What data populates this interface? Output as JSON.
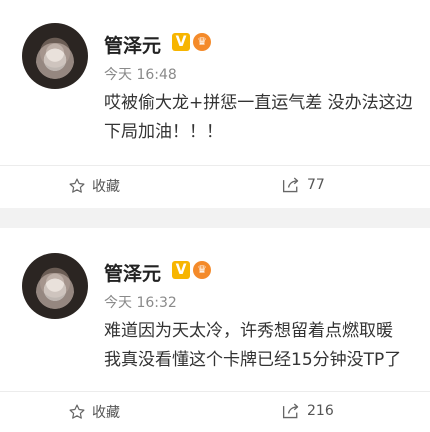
{
  "posts": [
    {
      "author": "管泽元",
      "badge_v": "V",
      "time": "今天 16:48",
      "lines": [
        "哎被偷大龙+拼惩一直运气差 没办法这边",
        "下局加油！！！"
      ],
      "favorite_label": "收藏",
      "forward_count": "77"
    },
    {
      "author": "管泽元",
      "badge_v": "V",
      "time": "今天 16:32",
      "lines": [
        "难道因为天太冷，许秀想留着点燃取暖",
        "我真没看懂这个卡牌已经15分钟没TP了"
      ],
      "favorite_label": "收藏",
      "forward_count": "216"
    }
  ],
  "icons": [
    "star-icon",
    "forward-icon",
    "verified-badge-icon",
    "member-badge-icon"
  ],
  "colors": {
    "verified": "#f7b500",
    "member": "#f48a2a",
    "divider": "#f2f2f2"
  }
}
